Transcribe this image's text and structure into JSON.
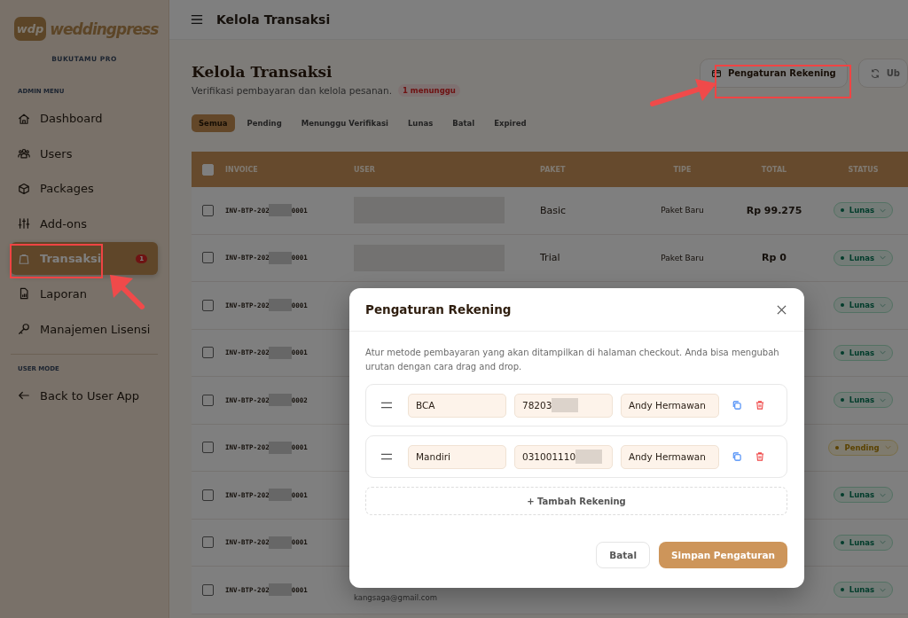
{
  "sidebar": {
    "logo_mark": "wdp",
    "logo_text": "weddingpress",
    "subtitle": "BUKUTAMU PRO",
    "sections": [
      {
        "heading": "ADMIN MENU",
        "items": [
          {
            "label": "Dashboard",
            "selected": false
          },
          {
            "label": "Users",
            "selected": false
          },
          {
            "label": "Packages",
            "selected": false
          },
          {
            "label": "Add-ons",
            "selected": false
          },
          {
            "label": "Transaksi",
            "selected": true,
            "badge": "1"
          },
          {
            "label": "Laporan",
            "selected": false
          },
          {
            "label": "Manajemen Lisensi",
            "selected": false
          }
        ]
      },
      {
        "heading": "USER MODE",
        "items": [
          {
            "label": "Back to User App",
            "selected": false
          }
        ]
      }
    ]
  },
  "topbar": {
    "title": "Kelola Transaksi"
  },
  "page": {
    "title": "Kelola Transaksi",
    "subtitle": "Verifikasi pembayaran dan kelola pesanan.",
    "pending_badge": "1 menunggu",
    "actions": [
      {
        "label": "Pengaturan Rekening"
      },
      {
        "label": "Ub"
      }
    ]
  },
  "filters": [
    {
      "label": "Semua",
      "selected": true
    },
    {
      "label": "Pending",
      "selected": false
    },
    {
      "label": "Menunggu Verifikasi",
      "selected": false
    },
    {
      "label": "Lunas",
      "selected": false
    },
    {
      "label": "Batal",
      "selected": false
    },
    {
      "label": "Expired",
      "selected": false
    }
  ],
  "table": {
    "all_checked": false,
    "columns": [
      "INVOICE",
      "USER",
      "PAKET",
      "TIPE",
      "TOTAL",
      "STATUS"
    ],
    "rows": [
      {
        "checked": false,
        "invoice_prefix": "INV-BTP-202",
        "invoice_suffix": "0001",
        "paket": "Basic",
        "tipe": "Paket Baru",
        "total": "Rp 99.275",
        "status": "Lunas",
        "kind": "paid"
      },
      {
        "checked": false,
        "invoice_prefix": "INV-BTP-202",
        "invoice_suffix": "0001",
        "paket": "Trial",
        "tipe": "Paket Baru",
        "total": "Rp 0",
        "status": "Lunas",
        "kind": "paid"
      },
      {
        "checked": false,
        "invoice_prefix": "INV-BTP-202",
        "invoice_suffix": "0001",
        "status": "Lunas",
        "kind": "paid"
      },
      {
        "checked": false,
        "invoice_prefix": "INV-BTP-202",
        "invoice_suffix": "0001",
        "status": "Lunas",
        "kind": "paid"
      },
      {
        "checked": false,
        "invoice_prefix": "INV-BTP-202",
        "invoice_suffix": "0002",
        "status": "Lunas",
        "kind": "paid"
      },
      {
        "checked": false,
        "invoice_prefix": "INV-BTP-202",
        "invoice_suffix": "0001",
        "status": "Pending",
        "kind": "pending"
      },
      {
        "checked": false,
        "invoice_prefix": "INV-BTP-202",
        "invoice_suffix": "0001",
        "status": "Lunas",
        "kind": "paid"
      },
      {
        "checked": false,
        "invoice_prefix": "INV-BTP-202",
        "invoice_suffix": "0001",
        "status": "Lunas",
        "kind": "paid"
      },
      {
        "checked": false,
        "invoice_prefix": "INV-BTP-202",
        "invoice_suffix": "0001",
        "user_email": "kangsaga@gmail.com",
        "status": "Lunas",
        "kind": "paid"
      }
    ]
  },
  "modal": {
    "title": "Pengaturan Rekening",
    "description": "Atur metode pembayaran yang akan ditampilkan di halaman checkout. Anda bisa mengubah urutan dengan cara drag and drop.",
    "accounts": [
      {
        "bank": "BCA",
        "number": "78203",
        "holder": "Andy Hermawan"
      },
      {
        "bank": "Mandiri",
        "number": "031001110",
        "holder": "Andy Hermawan"
      }
    ],
    "add_label": "+ Tambah Rekening",
    "cancel": "Batal",
    "save": "Simpan Pengaturan"
  }
}
